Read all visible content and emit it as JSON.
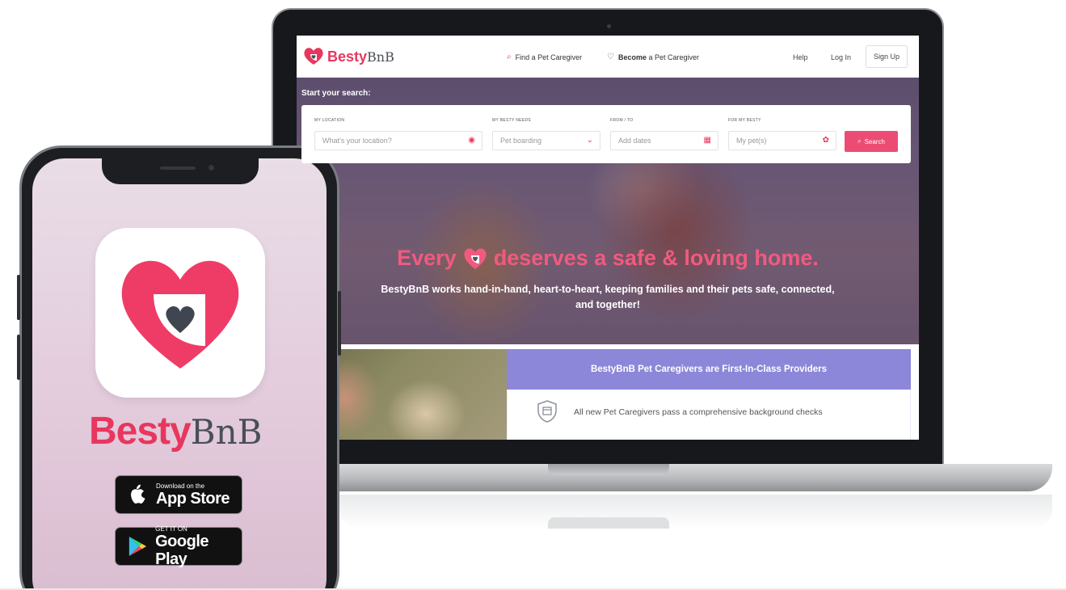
{
  "site": {
    "brand_main": "Besty",
    "brand_suffix": "BnB",
    "nav": {
      "find": "Find a Pet Caregiver",
      "become_bold": "Become",
      "become_rest": "a Pet Caregiver",
      "help": "Help",
      "login": "Log In",
      "signup": "Sign Up"
    },
    "search": {
      "title": "Start your search:",
      "location_label": "MY LOCATION",
      "location_placeholder": "What's your location?",
      "needs_label": "MY BESTY NEEDS",
      "needs_value": "Pet boarding",
      "dates_label": "FROM / TO",
      "dates_placeholder": "Add dates",
      "pets_label": "FOR MY BESTY",
      "pets_placeholder": "My pet(s)",
      "button": "Search"
    },
    "hero": {
      "headline_start": "Every",
      "headline_end": "deserves a safe & loving home.",
      "subtext": "BestyBnB works hand-in-hand, heart-to-heart, keeping families and their pets safe, connected, and together!"
    },
    "providers": {
      "banner": "BestyBnB Pet Caregivers are First-In-Class Providers",
      "item": "All new Pet Caregivers pass a comprehensive background checks"
    }
  },
  "app": {
    "name_main": "Besty",
    "name_suffix": "BnB",
    "appstore_small": "Download on the",
    "appstore_big": "App Store",
    "googleplay_small": "GET IT ON",
    "googleplay_big": "Google Play"
  },
  "colors": {
    "brand_pink": "#e8375f",
    "brand_gray": "#4a4f58",
    "banner_purple": "#8c87d8"
  }
}
